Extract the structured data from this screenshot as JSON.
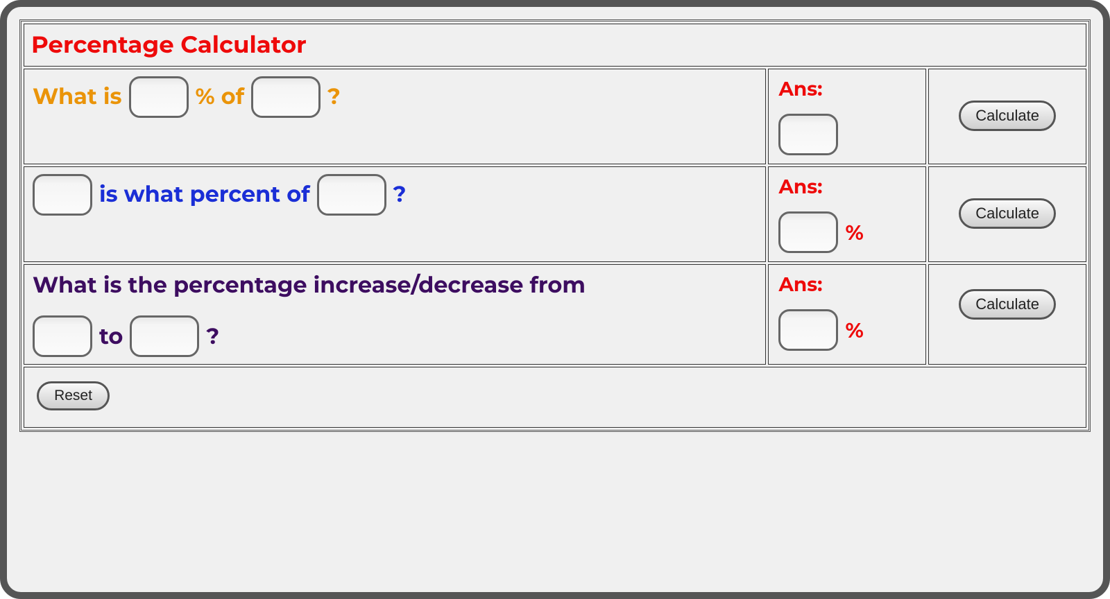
{
  "title": "Percentage Calculator",
  "row1": {
    "pre": "What is",
    "mid": "% of",
    "post": "?",
    "ansLabel": "Ans:",
    "btn": "Calculate"
  },
  "row2": {
    "mid": "is what percent of",
    "post": "?",
    "ansLabel": "Ans:",
    "pct": "%",
    "btn": "Calculate"
  },
  "row3": {
    "line1": "What is the percentage increase/decrease from",
    "to": "to",
    "post": "?",
    "ansLabel": "Ans:",
    "pct": "%",
    "btn": "Calculate"
  },
  "resetBtn": "Reset"
}
